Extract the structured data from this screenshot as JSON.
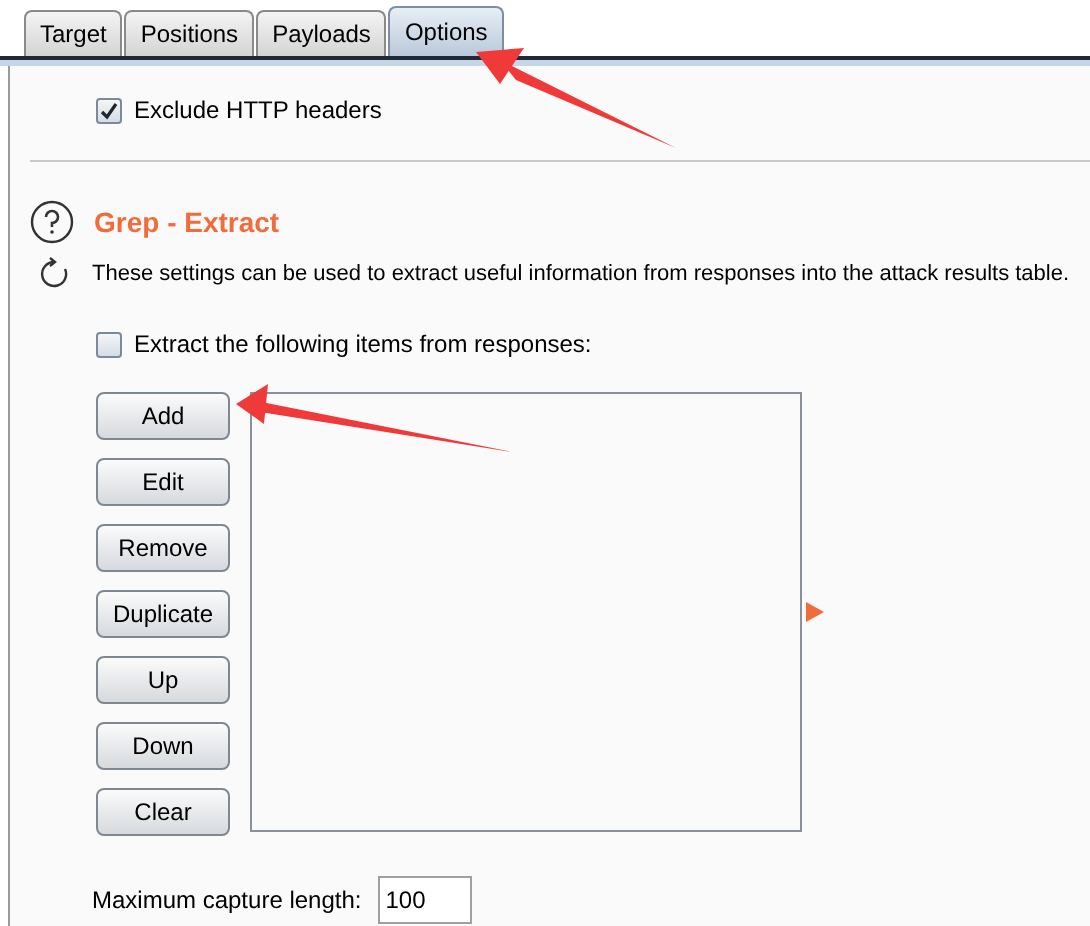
{
  "tabs": [
    {
      "label": "Target",
      "selected": false
    },
    {
      "label": "Positions",
      "selected": false
    },
    {
      "label": "Payloads",
      "selected": false
    },
    {
      "label": "Options",
      "selected": true
    }
  ],
  "exclude_headers": {
    "label": "Exclude HTTP headers",
    "checked": true
  },
  "section": {
    "title": "Grep - Extract",
    "description": "These settings can be used to extract useful information from responses into the attack results table."
  },
  "extract": {
    "label": "Extract the following items from responses:",
    "checked": false
  },
  "buttons": [
    "Add",
    "Edit",
    "Remove",
    "Duplicate",
    "Up",
    "Down",
    "Clear"
  ],
  "max_capture": {
    "label": "Maximum capture length:",
    "value": "100"
  }
}
